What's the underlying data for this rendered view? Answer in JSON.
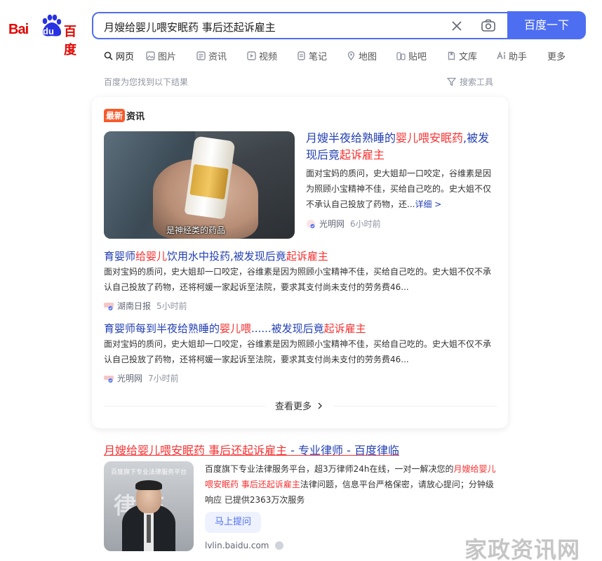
{
  "logo": {
    "bai": "Bai",
    "du": "du",
    "cn": "百度"
  },
  "search": {
    "query": "月嫂给婴儿喂安眠药 事后还起诉雇主",
    "button": "百度一下"
  },
  "tabs": [
    {
      "label": "网页",
      "icon": "search-icon"
    },
    {
      "label": "图片",
      "icon": "image-icon"
    },
    {
      "label": "资讯",
      "icon": "news-icon"
    },
    {
      "label": "视频",
      "icon": "video-icon"
    },
    {
      "label": "笔记",
      "icon": "note-icon"
    },
    {
      "label": "地图",
      "icon": "map-icon"
    },
    {
      "label": "贴吧",
      "icon": "tieba-icon"
    },
    {
      "label": "文库",
      "icon": "wenku-icon"
    },
    {
      "label": "助手",
      "icon": "ai-icon"
    },
    {
      "label": "更多",
      "icon": ""
    }
  ],
  "result_stats": "百度为您找到以下结果",
  "search_tools": "搜索工具",
  "news": {
    "badge_new": "最新",
    "badge_label": "资讯",
    "thumb_caption": "是神经类的药品",
    "top": {
      "title_a": "月嫂半夜给熟睡的",
      "title_b": "婴儿喂安眠药",
      "title_c": ",被发现后竟",
      "title_d": "起诉雇主",
      "summary": "面对宝妈的质问，史大姐却一口咬定，谷维素是因为照顾小宝精神不佳，买给自己吃的。史大姐不仅不承认自己投放了药物，还...",
      "more": "详细 >",
      "source": "光明网",
      "time": "6小时前"
    },
    "items": [
      {
        "title_a": "育婴师",
        "title_b": "给婴儿",
        "title_c": "饮用水中投药,被发现后竟",
        "title_d": "起诉雇主",
        "title_e": "",
        "summary": "面对宝妈的质问，史大姐却一口咬定，谷维素是因为照顾小宝精神不佳，买给自己吃的。史大姐不仅不承认自己投放了药物，还将柯媛一家起诉至法院，要求其支付尚未支付的劳务费46...",
        "source": "湖南日报",
        "time": "5小时前"
      },
      {
        "title_a": "育婴师每到半夜给熟睡的",
        "title_b": "婴儿喂",
        "title_c": "......被发现后竟",
        "title_d": "起诉雇主",
        "title_e": "",
        "summary": "面对宝妈的质问，史大姐却一口咬定，谷维素是因为照顾小宝精神不佳，买给自己吃的。史大姐不仅不承认自己投放了药物，还将柯媛一家起诉至法院，要求其支付尚未支付的劳务费46...",
        "source": "光明网",
        "time": "7小时前"
      }
    ],
    "see_more": "查看更多"
  },
  "ad": {
    "title_hl": "月嫂给婴儿喂安眠药 事后还起诉雇主",
    "title_rest": " - 专业律师 - 百度律临",
    "thumb_top": "百度旗下专业法律服务平台",
    "thumb_big": "律临",
    "desc_a": "百度旗下专业法律服务平台，超3万律师24h在线，一对一解决您的",
    "desc_hl": "月嫂给婴儿喂安眠药 事后还起诉雇主",
    "desc_b": "法律问题，信息平台严格保密，请放心提问；分钟级响应 已提供2363万次服务",
    "button": "马上提问",
    "url": "lvlin.baidu.com"
  },
  "watermark": "家政资讯网",
  "colors": {
    "accent": "#4e6ef2",
    "link": "#2440b3",
    "highlight": "#f73131",
    "logo_red": "#e10601"
  }
}
